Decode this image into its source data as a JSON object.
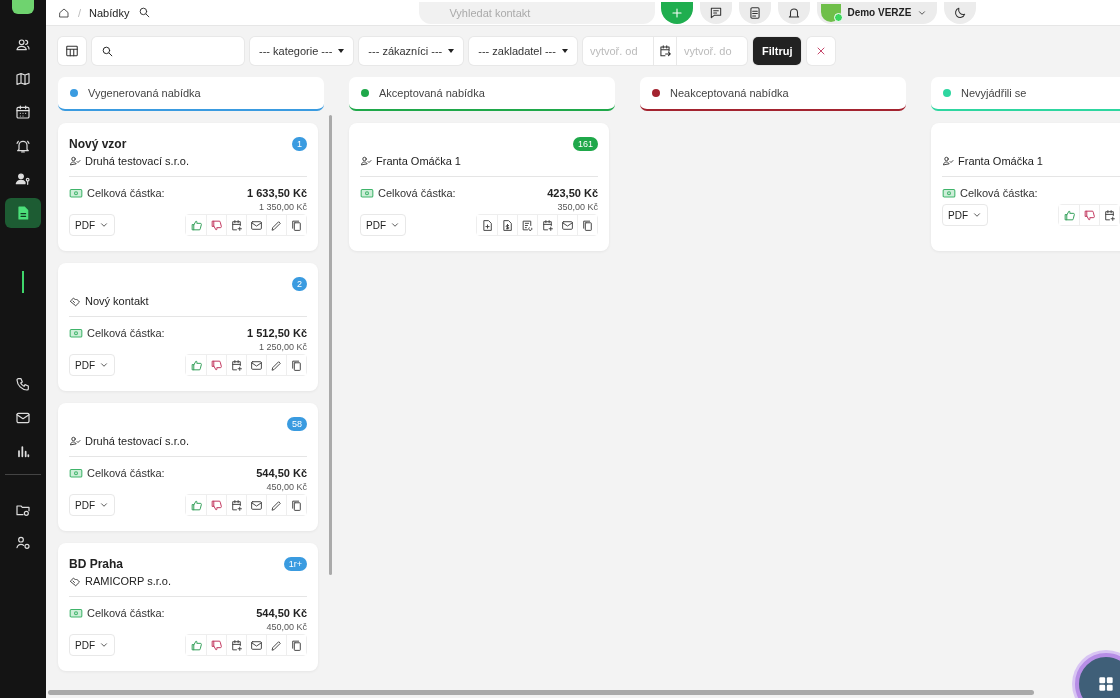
{
  "sidebar": {
    "items": [
      {
        "kind": "contacts",
        "selected": false
      },
      {
        "kind": "map",
        "selected": false
      },
      {
        "kind": "calendar",
        "selected": false
      },
      {
        "kind": "bell",
        "selected": false
      },
      {
        "kind": "person-key",
        "selected": false
      },
      {
        "kind": "document",
        "selected": true
      },
      {
        "kind": "phone",
        "selected": false
      },
      {
        "kind": "mail",
        "selected": false
      },
      {
        "kind": "chart",
        "selected": false
      },
      {
        "kind": "folder-gear",
        "selected": false
      },
      {
        "kind": "people-gear",
        "selected": false
      }
    ]
  },
  "breadcrumb": {
    "separator": "/",
    "current": "Nabídky"
  },
  "search": {
    "placeholder": "Vyhledat kontakt"
  },
  "user": {
    "name": "Demo VERZE"
  },
  "filters": {
    "dropdowns": [
      "--- kategorie ---",
      "--- zákazníci ---",
      "--- zakladatel ---"
    ],
    "date_from": {
      "placeholder": "vytvoř. od"
    },
    "date_to": {
      "placeholder": "vytvoř. do"
    },
    "filter_button": "Filtruj"
  },
  "columns": [
    {
      "title": "Vygenerovaná nabídka",
      "color": "#3a9be0",
      "cards": [
        {
          "title": "Nový vzor",
          "badge": "1",
          "contact": {
            "kind": "person",
            "name": "Druhá testovací s.r.o."
          },
          "amount_label": "Celková částka:",
          "total": "1 633,50 Kč",
          "subtotal": "1 350,00 Kč",
          "export": "PDF",
          "actions": [
            {
              "kind": "like"
            },
            {
              "kind": "dislike"
            },
            {
              "kind": "calendar-add"
            },
            {
              "kind": "mail"
            },
            {
              "kind": "edit"
            },
            {
              "kind": "copy"
            }
          ]
        },
        {
          "badge": "2",
          "contact": {
            "kind": "company",
            "name": "Nový kontakt"
          },
          "amount_label": "Celková částka:",
          "total": "1 512,50 Kč",
          "subtotal": "1 250,00 Kč",
          "export": "PDF",
          "actions": [
            {
              "kind": "like"
            },
            {
              "kind": "dislike"
            },
            {
              "kind": "calendar-add"
            },
            {
              "kind": "mail"
            },
            {
              "kind": "edit"
            },
            {
              "kind": "copy"
            }
          ]
        },
        {
          "badge": "58",
          "contact": {
            "kind": "person",
            "name": "Druhá testovací s.r.o."
          },
          "amount_label": "Celková částka:",
          "total": "544,50 Kč",
          "subtotal": "450,00 Kč",
          "export": "PDF",
          "actions": [
            {
              "kind": "like"
            },
            {
              "kind": "dislike"
            },
            {
              "kind": "calendar-add"
            },
            {
              "kind": "mail"
            },
            {
              "kind": "edit"
            },
            {
              "kind": "copy"
            }
          ]
        },
        {
          "title": "BD Praha",
          "badge": "1r+",
          "contact": {
            "kind": "company",
            "name": "RAMICORP s.r.o."
          },
          "amount_label": "Celková částka:",
          "total": "544,50 Kč",
          "subtotal": "450,00 Kč",
          "export": "PDF",
          "actions": [
            {
              "kind": "like"
            },
            {
              "kind": "dislike"
            },
            {
              "kind": "calendar-add"
            },
            {
              "kind": "mail"
            },
            {
              "kind": "edit"
            },
            {
              "kind": "copy"
            }
          ]
        }
      ]
    },
    {
      "title": "Akceptovaná nabídka",
      "color": "#1fa84a",
      "cards": [
        {
          "badge": "161",
          "contact": {
            "kind": "person",
            "name": "Franta Omáčka 1"
          },
          "amount_label": "Celková částka:",
          "total": "423,50 Kč",
          "subtotal": "350,00 Kč",
          "export": "PDF",
          "actions": [
            {
              "kind": "doc-add"
            },
            {
              "kind": "doc-money"
            },
            {
              "kind": "doc-refresh"
            },
            {
              "kind": "calendar-add"
            },
            {
              "kind": "mail"
            },
            {
              "kind": "copy"
            }
          ]
        }
      ]
    },
    {
      "title": "Neakceptovaná nabídka",
      "color": "#a3232f"
    },
    {
      "title": "Nevyjádřili se",
      "color": "#2ed6a0",
      "cards": [
        {
          "contact": {
            "kind": "person",
            "name": "Franta Omáčka 1"
          },
          "amount_label": "Celková částka:",
          "export": "PDF",
          "actions": [
            {
              "kind": "like"
            },
            {
              "kind": "dislike"
            },
            {
              "kind": "calendar-add"
            }
          ]
        }
      ]
    }
  ]
}
